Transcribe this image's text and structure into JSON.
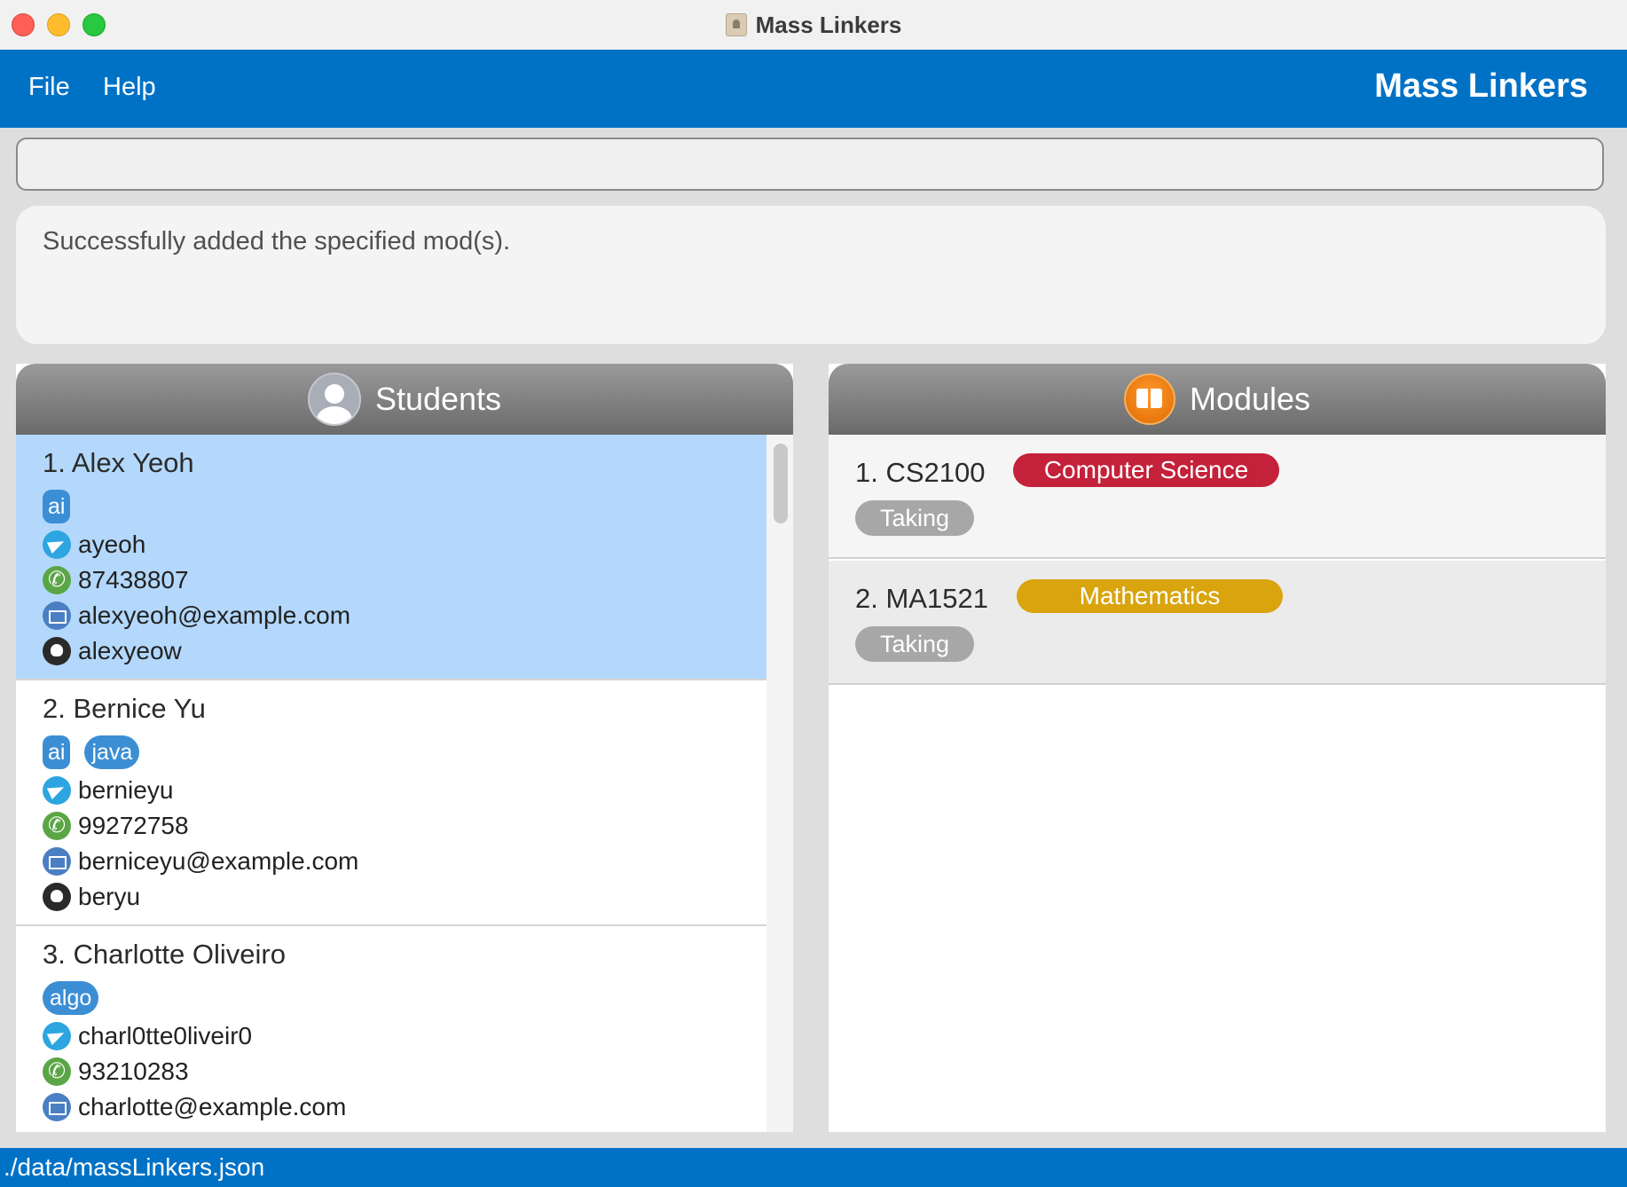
{
  "window": {
    "title": "Mass Linkers"
  },
  "menu": {
    "file": "File",
    "help": "Help",
    "brand": "Mass Linkers"
  },
  "command": {
    "value": ""
  },
  "result": {
    "message": "Successfully added the specified mod(s)."
  },
  "students_panel": {
    "title": "Students",
    "items": [
      {
        "name": "1. Alex Yeoh",
        "tags": [
          "ai"
        ],
        "telegram": "ayeoh",
        "phone": "87438807",
        "email": "alexyeoh@example.com",
        "github": "alexyeow"
      },
      {
        "name": "2. Bernice Yu",
        "tags": [
          "ai",
          "java"
        ],
        "telegram": "bernieyu",
        "phone": "99272758",
        "email": "berniceyu@example.com",
        "github": "beryu"
      },
      {
        "name": "3. Charlotte Oliveiro",
        "tags": [
          "algo"
        ],
        "telegram": "charl0tte0liveir0",
        "phone": "93210283",
        "email": "charlotte@example.com",
        "github": ""
      }
    ]
  },
  "modules_panel": {
    "title": "Modules",
    "items": [
      {
        "code": "1. CS2100",
        "tag": "Computer Science",
        "tag_color": "#c4213a",
        "status": "Taking"
      },
      {
        "code": "2. MA1521",
        "tag": "Mathematics",
        "tag_color": "#d9a40e",
        "status": "Taking"
      }
    ]
  },
  "status": {
    "path": "./data/massLinkers.json"
  },
  "colors": {
    "accent": "#0072c6",
    "selection": "#b3d8fb",
    "tag": "#3c8ed4"
  }
}
